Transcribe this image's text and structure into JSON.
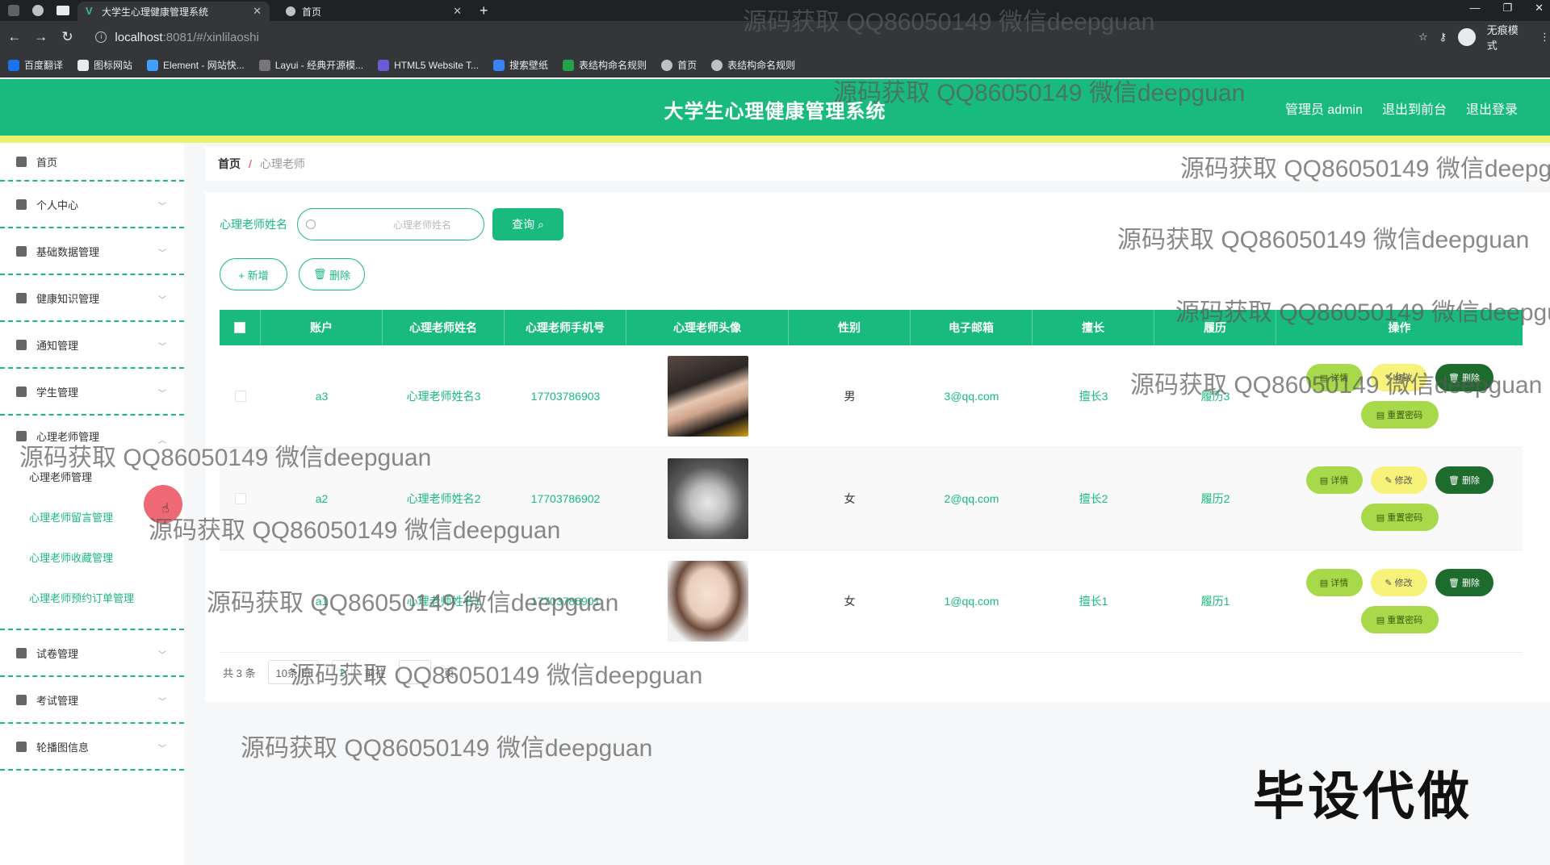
{
  "browser": {
    "tabs": [
      {
        "title": "大学生心理健康管理系统",
        "active": true
      },
      {
        "title": "首页",
        "active": false
      }
    ],
    "url_host": "localhost",
    "url_path": ":8081/#/xinlilaoshi",
    "incognito_label": "无痕模式",
    "bookmarks": [
      "百度翻译",
      "图标网站",
      "Element - 网站快...",
      "Layui - 经典开源模...",
      "HTML5 Website T...",
      "搜索壁纸",
      "表结构命名规则",
      "首页",
      "表结构命名规则"
    ]
  },
  "header": {
    "title": "大学生心理健康管理系统",
    "user": "管理员 admin",
    "to_front": "退出到前台",
    "logout": "退出登录"
  },
  "sidebar": {
    "home": "首页",
    "items": [
      "个人中心",
      "基础数据管理",
      "健康知识管理",
      "通知管理",
      "学生管理"
    ],
    "open_group": "心理老师管理",
    "sub_items": [
      "心理老师管理",
      "心理老师留言管理",
      "心理老师收藏管理",
      "心理老师预约订单管理"
    ],
    "items_after": [
      "试卷管理",
      "考试管理",
      "轮播图信息"
    ]
  },
  "breadcrumb": {
    "home": "首页",
    "separator": "/",
    "current": "心理老师"
  },
  "search": {
    "label": "心理老师姓名",
    "placeholder": "心理老师姓名",
    "button": "查询"
  },
  "actions": {
    "add": "+ 新增",
    "delete": "删除"
  },
  "table": {
    "columns": [
      "账户",
      "心理老师姓名",
      "心理老师手机号",
      "心理老师头像",
      "性别",
      "电子邮箱",
      "擅长",
      "履历",
      "操作"
    ],
    "rows": [
      {
        "account": "a3",
        "name": "心理老师姓名3",
        "phone": "17703786903",
        "gender": "男",
        "email": "3@qq.com",
        "specialty": "擅长3",
        "resume": "履历3"
      },
      {
        "account": "a2",
        "name": "心理老师姓名2",
        "phone": "17703786902",
        "gender": "女",
        "email": "2@qq.com",
        "specialty": "擅长2",
        "resume": "履历2"
      },
      {
        "account": "a1",
        "name": "心理老师姓名1",
        "phone": "17703786901",
        "gender": "女",
        "email": "1@qq.com",
        "specialty": "擅长1",
        "resume": "履历1"
      }
    ],
    "ops": {
      "detail": "详情",
      "edit": "修改",
      "delete": "删除",
      "reset": "重置密码"
    }
  },
  "pager": {
    "total": "共 3 条",
    "page_size": "10条/页",
    "current_page": "1",
    "goto": "前往",
    "page_unit": "页"
  },
  "watermark": "源码获取 QQ86050149 微信deepguan",
  "corner_text": "毕设代做",
  "colors": {
    "primary": "#19ba7e",
    "accent_bar": "#eaf26c",
    "detail": "#a7d94b",
    "edit": "#f6f27a",
    "delete": "#1e6b2e"
  }
}
